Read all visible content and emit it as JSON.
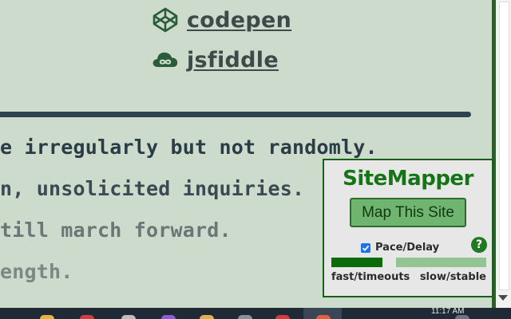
{
  "links": [
    {
      "label": "codepen",
      "icon": "codepen-icon"
    },
    {
      "label": "jsfiddle",
      "icon": "jsfiddle-cloud-icon"
    }
  ],
  "text_lines": [
    "e irregularly but not randomly.",
    "n, unsolicited inquiries.",
    "till march forward.",
    "ength."
  ],
  "sitemapper": {
    "title": "SiteMapper",
    "map_button": "Map This Site",
    "pace_label": "Pace/Delay",
    "pace_checked": true,
    "help": "?",
    "slider_value": 0.33,
    "slider_min_label": "fast/timeouts",
    "slider_max_label": "slow/stable"
  },
  "taskbar": {
    "time": "11:17 AM"
  },
  "colors": {
    "background": "#ccdbcc",
    "link": "#3e4a4a",
    "panel_accent": "#137513",
    "button": "#6fb46f"
  }
}
